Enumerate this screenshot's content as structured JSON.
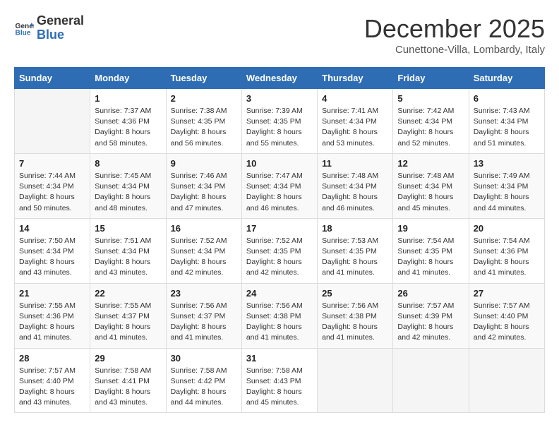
{
  "logo": {
    "text_general": "General",
    "text_blue": "Blue"
  },
  "title": "December 2025",
  "location": "Cunettone-Villa, Lombardy, Italy",
  "days_of_week": [
    "Sunday",
    "Monday",
    "Tuesday",
    "Wednesday",
    "Thursday",
    "Friday",
    "Saturday"
  ],
  "weeks": [
    [
      {
        "day": "",
        "detail": ""
      },
      {
        "day": "1",
        "detail": "Sunrise: 7:37 AM\nSunset: 4:36 PM\nDaylight: 8 hours\nand 58 minutes."
      },
      {
        "day": "2",
        "detail": "Sunrise: 7:38 AM\nSunset: 4:35 PM\nDaylight: 8 hours\nand 56 minutes."
      },
      {
        "day": "3",
        "detail": "Sunrise: 7:39 AM\nSunset: 4:35 PM\nDaylight: 8 hours\nand 55 minutes."
      },
      {
        "day": "4",
        "detail": "Sunrise: 7:41 AM\nSunset: 4:34 PM\nDaylight: 8 hours\nand 53 minutes."
      },
      {
        "day": "5",
        "detail": "Sunrise: 7:42 AM\nSunset: 4:34 PM\nDaylight: 8 hours\nand 52 minutes."
      },
      {
        "day": "6",
        "detail": "Sunrise: 7:43 AM\nSunset: 4:34 PM\nDaylight: 8 hours\nand 51 minutes."
      }
    ],
    [
      {
        "day": "7",
        "detail": "Sunrise: 7:44 AM\nSunset: 4:34 PM\nDaylight: 8 hours\nand 50 minutes."
      },
      {
        "day": "8",
        "detail": "Sunrise: 7:45 AM\nSunset: 4:34 PM\nDaylight: 8 hours\nand 48 minutes."
      },
      {
        "day": "9",
        "detail": "Sunrise: 7:46 AM\nSunset: 4:34 PM\nDaylight: 8 hours\nand 47 minutes."
      },
      {
        "day": "10",
        "detail": "Sunrise: 7:47 AM\nSunset: 4:34 PM\nDaylight: 8 hours\nand 46 minutes."
      },
      {
        "day": "11",
        "detail": "Sunrise: 7:48 AM\nSunset: 4:34 PM\nDaylight: 8 hours\nand 46 minutes."
      },
      {
        "day": "12",
        "detail": "Sunrise: 7:48 AM\nSunset: 4:34 PM\nDaylight: 8 hours\nand 45 minutes."
      },
      {
        "day": "13",
        "detail": "Sunrise: 7:49 AM\nSunset: 4:34 PM\nDaylight: 8 hours\nand 44 minutes."
      }
    ],
    [
      {
        "day": "14",
        "detail": "Sunrise: 7:50 AM\nSunset: 4:34 PM\nDaylight: 8 hours\nand 43 minutes."
      },
      {
        "day": "15",
        "detail": "Sunrise: 7:51 AM\nSunset: 4:34 PM\nDaylight: 8 hours\nand 43 minutes."
      },
      {
        "day": "16",
        "detail": "Sunrise: 7:52 AM\nSunset: 4:34 PM\nDaylight: 8 hours\nand 42 minutes."
      },
      {
        "day": "17",
        "detail": "Sunrise: 7:52 AM\nSunset: 4:35 PM\nDaylight: 8 hours\nand 42 minutes."
      },
      {
        "day": "18",
        "detail": "Sunrise: 7:53 AM\nSunset: 4:35 PM\nDaylight: 8 hours\nand 41 minutes."
      },
      {
        "day": "19",
        "detail": "Sunrise: 7:54 AM\nSunset: 4:35 PM\nDaylight: 8 hours\nand 41 minutes."
      },
      {
        "day": "20",
        "detail": "Sunrise: 7:54 AM\nSunset: 4:36 PM\nDaylight: 8 hours\nand 41 minutes."
      }
    ],
    [
      {
        "day": "21",
        "detail": "Sunrise: 7:55 AM\nSunset: 4:36 PM\nDaylight: 8 hours\nand 41 minutes."
      },
      {
        "day": "22",
        "detail": "Sunrise: 7:55 AM\nSunset: 4:37 PM\nDaylight: 8 hours\nand 41 minutes."
      },
      {
        "day": "23",
        "detail": "Sunrise: 7:56 AM\nSunset: 4:37 PM\nDaylight: 8 hours\nand 41 minutes."
      },
      {
        "day": "24",
        "detail": "Sunrise: 7:56 AM\nSunset: 4:38 PM\nDaylight: 8 hours\nand 41 minutes."
      },
      {
        "day": "25",
        "detail": "Sunrise: 7:56 AM\nSunset: 4:38 PM\nDaylight: 8 hours\nand 41 minutes."
      },
      {
        "day": "26",
        "detail": "Sunrise: 7:57 AM\nSunset: 4:39 PM\nDaylight: 8 hours\nand 42 minutes."
      },
      {
        "day": "27",
        "detail": "Sunrise: 7:57 AM\nSunset: 4:40 PM\nDaylight: 8 hours\nand 42 minutes."
      }
    ],
    [
      {
        "day": "28",
        "detail": "Sunrise: 7:57 AM\nSunset: 4:40 PM\nDaylight: 8 hours\nand 43 minutes."
      },
      {
        "day": "29",
        "detail": "Sunrise: 7:58 AM\nSunset: 4:41 PM\nDaylight: 8 hours\nand 43 minutes."
      },
      {
        "day": "30",
        "detail": "Sunrise: 7:58 AM\nSunset: 4:42 PM\nDaylight: 8 hours\nand 44 minutes."
      },
      {
        "day": "31",
        "detail": "Sunrise: 7:58 AM\nSunset: 4:43 PM\nDaylight: 8 hours\nand 45 minutes."
      },
      {
        "day": "",
        "detail": ""
      },
      {
        "day": "",
        "detail": ""
      },
      {
        "day": "",
        "detail": ""
      }
    ]
  ]
}
